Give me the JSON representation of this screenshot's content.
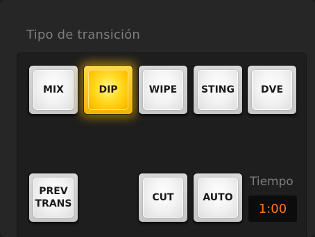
{
  "panel": {
    "title": "Tipo de transición"
  },
  "buttons": {
    "mix": "MIX",
    "dip": "DIP",
    "wipe": "WIPE",
    "sting": "STING",
    "dve": "DVE",
    "prev_trans": "PREV\nTRANS",
    "cut": "CUT",
    "auto": "AUTO"
  },
  "active_transition": "DIP",
  "colors": {
    "active": "#ffc400",
    "timer_text": "#ff7a1a",
    "panel_bg": "#262626"
  },
  "time": {
    "label": "Tiempo",
    "value": "1:00"
  }
}
